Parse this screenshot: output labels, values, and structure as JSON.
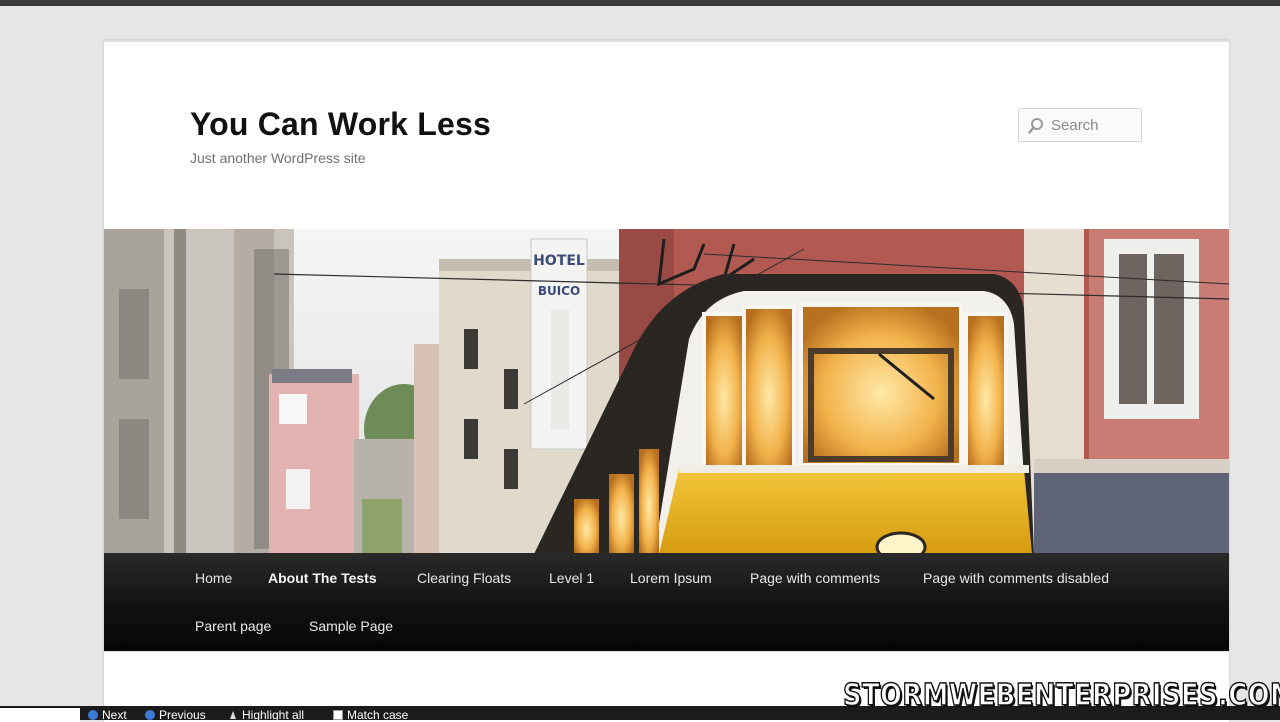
{
  "site": {
    "title": "You Can Work Less",
    "description": "Just another WordPress site"
  },
  "search": {
    "placeholder": "Search",
    "icon": "magnifier-icon"
  },
  "nav": {
    "row1": [
      {
        "label": "Home"
      },
      {
        "label": "About The Tests",
        "active": true
      },
      {
        "label": "Clearing Floats"
      },
      {
        "label": "Level 1"
      },
      {
        "label": "Lorem Ipsum"
      },
      {
        "label": "Page with comments"
      },
      {
        "label": "Page with comments disabled"
      }
    ],
    "row2": [
      {
        "label": "Parent page"
      },
      {
        "label": "Sample Page"
      }
    ]
  },
  "header_image": {
    "sign_letters_top": "HOTEL",
    "sign_letters_mid": "BUICO"
  },
  "findbar": {
    "next": "Next",
    "previous": "Previous",
    "highlight": "Highlight all",
    "match_case": "Match case"
  },
  "watermark": "STORMWEBENTERPRISES.COM",
  "colors": {
    "nav_bg": "#0a0a0a",
    "tram_yellow": "#e8b51f",
    "page_bg": "#ffffff"
  }
}
